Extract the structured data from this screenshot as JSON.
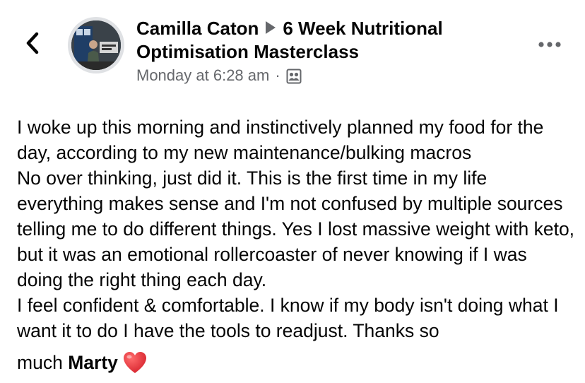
{
  "header": {
    "back_icon": "chevron-left-icon",
    "avatar_icon": "profile-photo",
    "author": "Camilla Caton",
    "separator_icon": "play-arrow-icon",
    "group": "6 Week Nutritional Optimisation Masterclass",
    "timestamp": "Monday at 6:28 am",
    "dot": "·",
    "privacy_icon": "group-members-icon",
    "more_icon": "more-horizontal-icon"
  },
  "post": {
    "paragraph_1": "I woke up this morning and instinctively planned my food for the day, according to my new maintenance/bulking macros",
    "paragraph_2": "No over thinking, just did it. This is the first time in my life everything makes sense and I'm not confused by multiple sources telling me to do different things. Yes I lost massive weight with keto, but it was an emotional rollercoaster of never knowing if I was doing the right thing each day.",
    "paragraph_3": "I feel confident & comfortable. I know if my body isn't doing what I want it to do I have the tools to readjust. Thanks so",
    "paragraph_4_prefix": "much",
    "mention": "Marty",
    "emoji_icon": "red-heart-icon"
  },
  "colors": {
    "text": "#050505",
    "secondary_text": "#65676b",
    "heart": "#e3322f"
  }
}
